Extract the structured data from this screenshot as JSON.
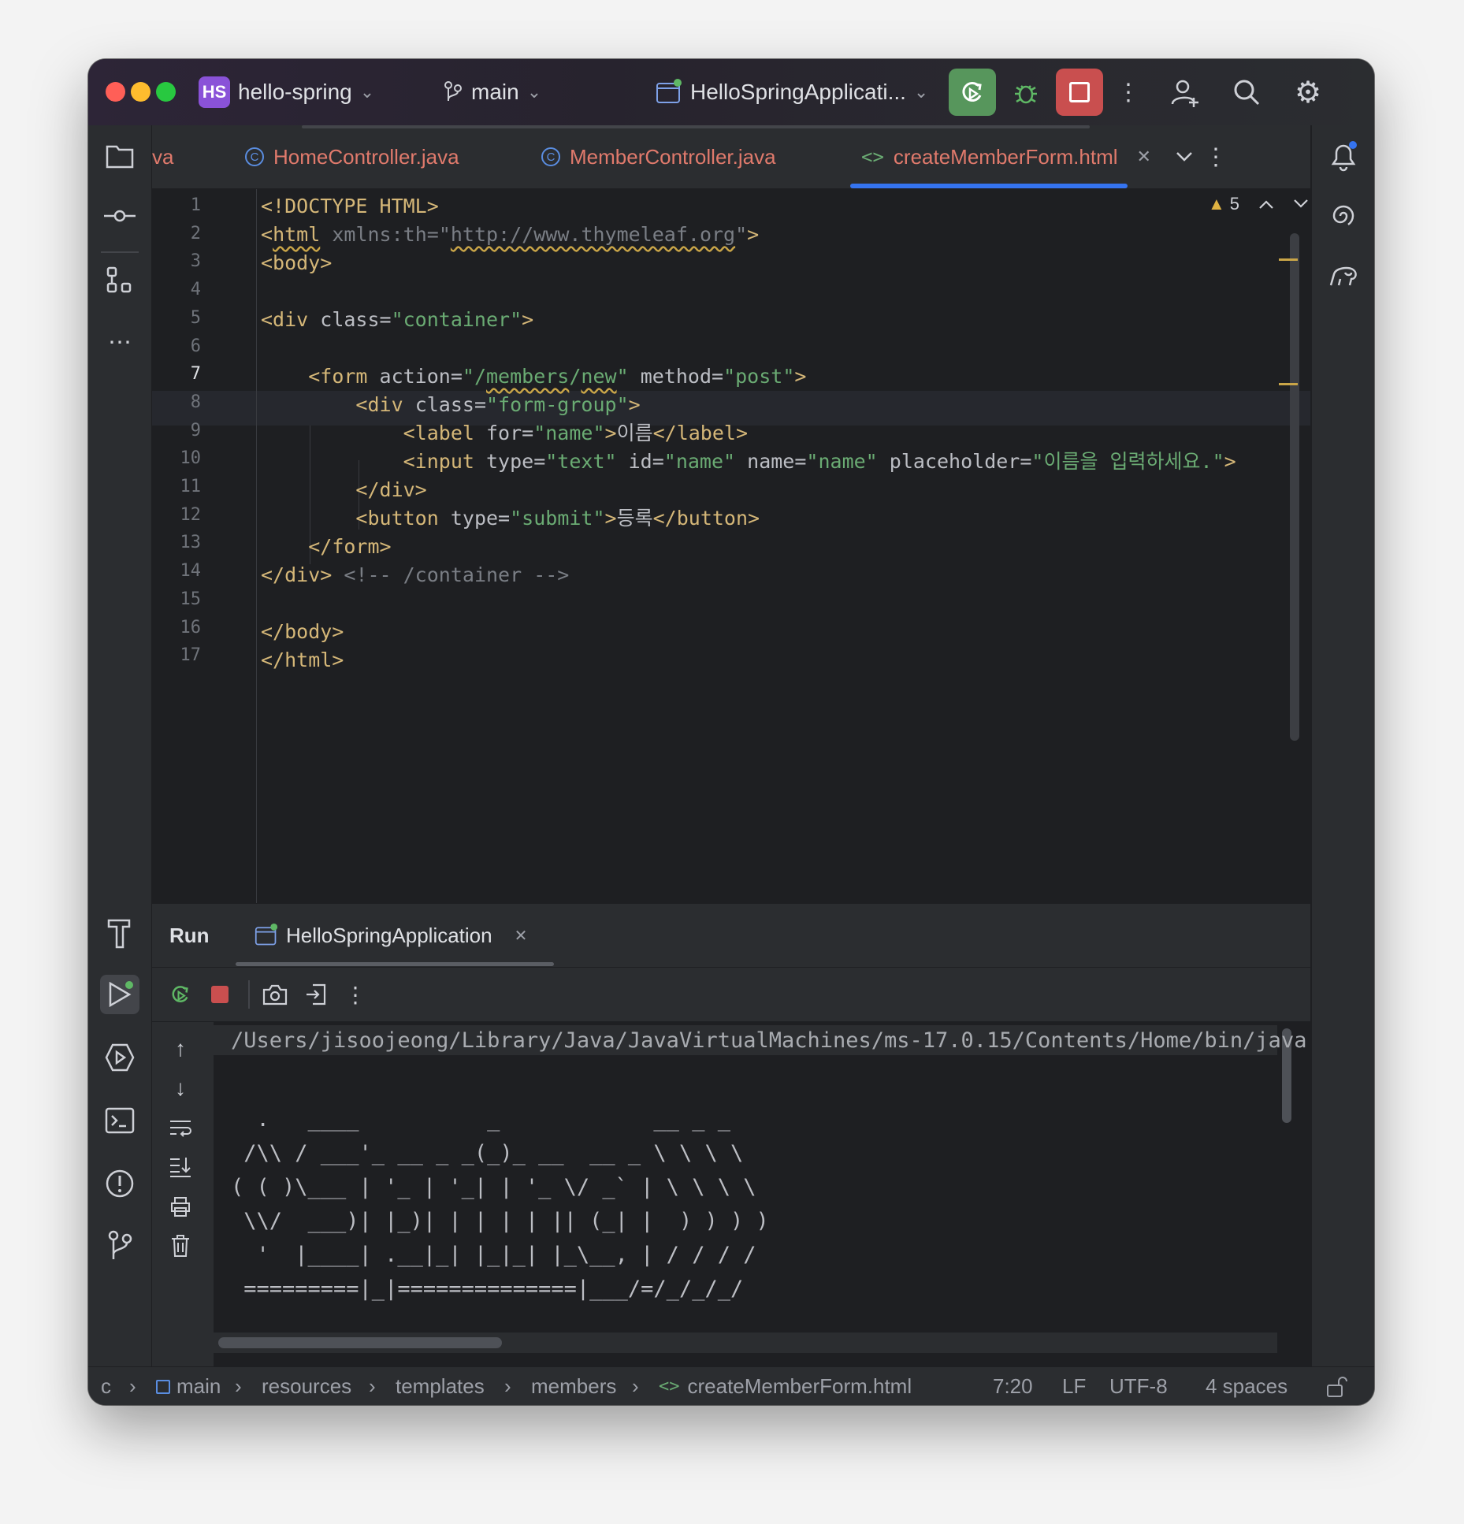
{
  "titlebar": {
    "project_badge": "HS",
    "project_name": "hello-spring",
    "branch": "main",
    "run_config": "HelloSpringApplicati..."
  },
  "tabs": [
    {
      "label": "va"
    },
    {
      "label": "HomeController.java"
    },
    {
      "label": "MemberController.java"
    },
    {
      "label": "createMemberForm.html"
    }
  ],
  "editor": {
    "warning_count": "5",
    "line_numbers": [
      "1",
      "2",
      "3",
      "4",
      "5",
      "6",
      "7",
      "8",
      "9",
      "10",
      "11",
      "12",
      "13",
      "14",
      "15",
      "16",
      "17"
    ]
  },
  "run_panel": {
    "title": "Run",
    "tab_label": "HelloSpringApplication",
    "console_lines": [
      "/Users/jisoojeong/Library/Java/JavaVirtualMachines/ms-17.0.15/Contents/Home/bin/java .",
      "",
      "  .   ____          _            __ _ _",
      " /\\\\ / ___'_ __ _ _(_)_ __  __ _ \\ \\ \\ \\",
      "( ( )\\___ | '_ | '_| | '_ \\/ _` | \\ \\ \\ \\",
      " \\\\/  ___)| |_)| | | | | || (_| |  ) ) ) )",
      "  '  |____| .__|_| |_|_| |_\\__, | / / / /",
      " =========|_|==============|___/=/_/_/_/"
    ]
  },
  "statusbar": {
    "crumb_0": "c",
    "crumb_1": "main",
    "crumb_2": "resources",
    "crumb_3": "templates",
    "crumb_4": "members",
    "crumb_5": "createMemberForm.html",
    "position": "7:20",
    "line_sep": "LF",
    "encoding": "UTF-8",
    "indent": "4 spaces"
  },
  "colors": {
    "accent": "#3574f0",
    "tag": "#d5b778",
    "string": "#6aab73",
    "run_green": "#57965c",
    "stop_red": "#c94f4f"
  }
}
